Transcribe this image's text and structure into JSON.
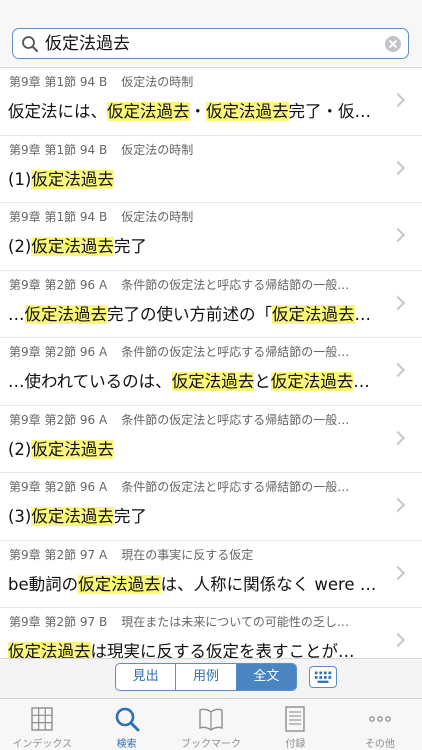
{
  "search": {
    "query": "仮定法過去"
  },
  "results": [
    {
      "section": "第9章 第1節 94 B",
      "topic": "仮定法の時制",
      "text": [
        [
          "仮定法には、",
          0
        ],
        [
          "仮定法過去",
          1
        ],
        [
          "・",
          0
        ],
        [
          "仮定法過去",
          1
        ],
        [
          "完了・仮定…",
          0
        ]
      ]
    },
    {
      "section": "第9章 第1節 94 B",
      "topic": "仮定法の時制",
      "text": [
        [
          "(1)",
          0
        ],
        [
          "仮定法過去",
          1
        ]
      ]
    },
    {
      "section": "第9章 第1節 94 B",
      "topic": "仮定法の時制",
      "text": [
        [
          "(2)",
          0
        ],
        [
          "仮定法過去",
          1
        ],
        [
          "完了",
          0
        ]
      ]
    },
    {
      "section": "第9章 第2節 96 A",
      "topic": "条件節の仮定法と呼応する帰結節の一般…",
      "text": [
        [
          "…",
          0
        ],
        [
          "仮定法過去",
          1
        ],
        [
          "完了の使い方前述の「",
          0
        ],
        [
          "仮定法過去",
          1
        ],
        [
          "…",
          0
        ]
      ]
    },
    {
      "section": "第9章 第2節 96 A",
      "topic": "条件節の仮定法と呼応する帰結節の一般…",
      "text": [
        [
          "…使われているのは、",
          0
        ],
        [
          "仮定法過去",
          1
        ],
        [
          "と",
          0
        ],
        [
          "仮定法過去",
          1
        ],
        [
          "…",
          0
        ]
      ]
    },
    {
      "section": "第9章 第2節 96 A",
      "topic": "条件節の仮定法と呼応する帰結節の一般…",
      "text": [
        [
          "(2)",
          0
        ],
        [
          "仮定法過去",
          1
        ]
      ]
    },
    {
      "section": "第9章 第2節 96 A",
      "topic": "条件節の仮定法と呼応する帰結節の一般…",
      "text": [
        [
          "(3)",
          0
        ],
        [
          "仮定法過去",
          1
        ],
        [
          "完了",
          0
        ]
      ]
    },
    {
      "section": "第9章 第2節 97 A",
      "topic": "現在の事実に反する仮定",
      "text": [
        [
          "be動詞の",
          0
        ],
        [
          "仮定法過去",
          1
        ],
        [
          "は、人称に関係なく were …",
          0
        ]
      ]
    },
    {
      "section": "第9章 第2節 97 B",
      "topic": "現在または未来についての可能性の乏し…",
      "text": [
        [
          "仮定法過去",
          1
        ],
        [
          "は現実に反する仮定を表すことが…",
          0
        ]
      ]
    }
  ],
  "segments": {
    "items": [
      "見出",
      "用例",
      "全文"
    ],
    "active": 2
  },
  "tabs": [
    {
      "label": "インデックス",
      "icon": "grid-icon"
    },
    {
      "label": "検索",
      "icon": "search-icon",
      "active": true
    },
    {
      "label": "ブックマーク",
      "icon": "book-icon"
    },
    {
      "label": "付録",
      "icon": "document-icon"
    },
    {
      "label": "その他",
      "icon": "more-icon"
    }
  ],
  "colors": {
    "accent": "#2f6fb3",
    "highlight": "#fbf77b"
  }
}
